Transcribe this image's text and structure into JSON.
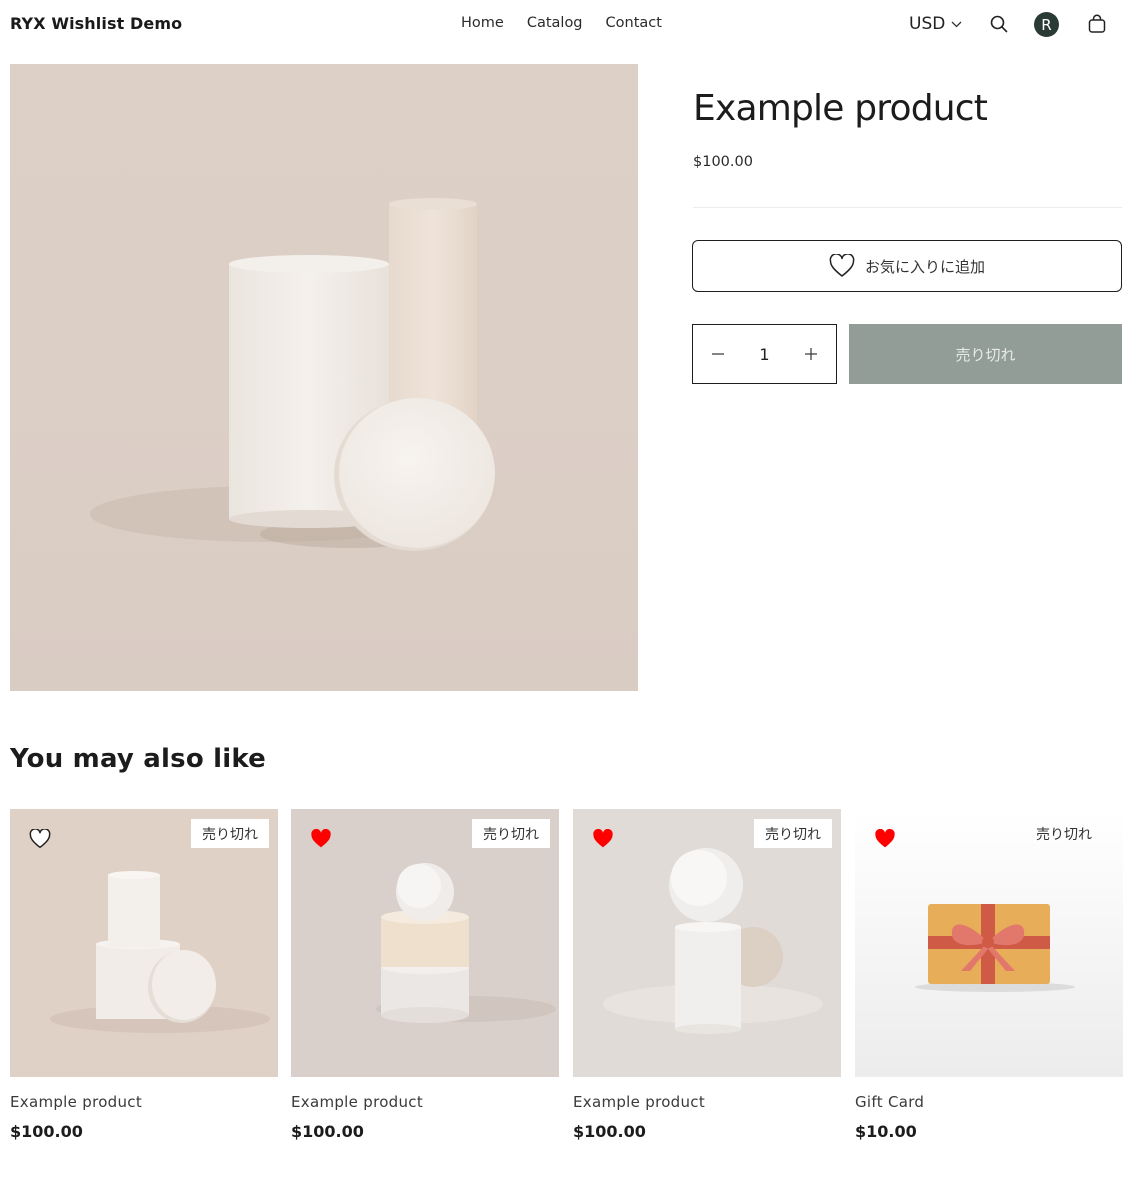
{
  "header": {
    "logo": "RYX Wishlist Demo",
    "nav": [
      "Home",
      "Catalog",
      "Contact"
    ],
    "currency": "USD",
    "avatar_initial": "R"
  },
  "product": {
    "title": "Example product",
    "price": "$100.00",
    "wishlist_label": "お気に入りに追加",
    "quantity": "1",
    "soldout_label": "売り切れ"
  },
  "related": {
    "heading": "You may also like",
    "items": [
      {
        "title": "Example product",
        "price": "$100.00",
        "badge": "売り切れ",
        "wishlisted": false
      },
      {
        "title": "Example product",
        "price": "$100.00",
        "badge": "売り切れ",
        "wishlisted": true
      },
      {
        "title": "Example product",
        "price": "$100.00",
        "badge": "売り切れ",
        "wishlisted": true
      },
      {
        "title": "Gift Card",
        "price": "$10.00",
        "badge": "売り切れ",
        "wishlisted": true
      }
    ]
  },
  "colors": {
    "heart_active": "#ff0000",
    "soldout_bg": "#939d98",
    "avatar_bg": "#2a3a34"
  }
}
